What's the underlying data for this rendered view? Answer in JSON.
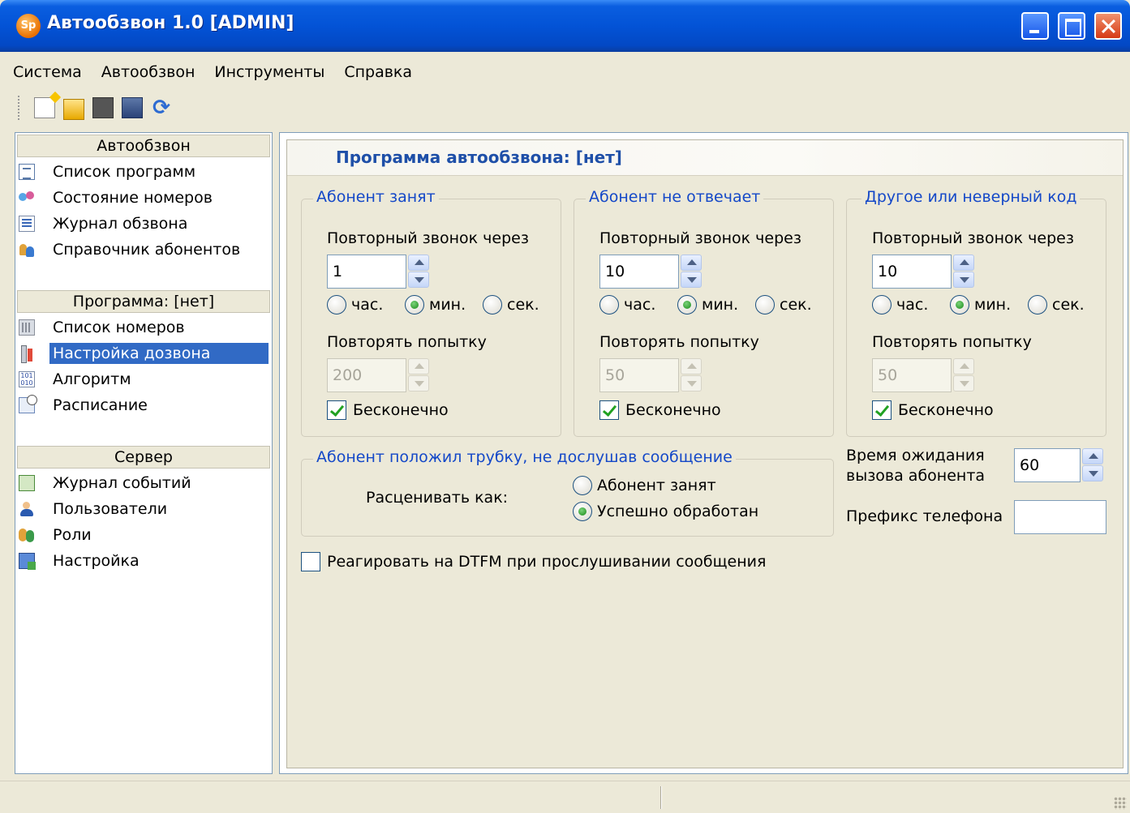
{
  "window": {
    "title": "Автообзвон 1.0 [ADMIN]",
    "app_icon_text": "Sp"
  },
  "menu": [
    "Система",
    "Автообзвон",
    "Инструменты",
    "Справка"
  ],
  "toolbar": {
    "icons": [
      "new-file-icon",
      "open-folder-icon",
      "save-icon",
      "save-all-icon",
      "refresh-icon"
    ]
  },
  "sidebar": {
    "sections": [
      {
        "header": "Автообзвон",
        "items": [
          {
            "label": "Список программ",
            "icon": "list-icon"
          },
          {
            "label": "Состояние номеров",
            "icon": "status-icon"
          },
          {
            "label": "Журнал обзвона",
            "icon": "journal-icon"
          },
          {
            "label": "Справочник абонентов",
            "icon": "address-book-icon"
          }
        ]
      },
      {
        "header": "Программа: [нет]",
        "items": [
          {
            "label": "Список номеров",
            "icon": "phone-list-icon"
          },
          {
            "label": "Настройка дозвона",
            "icon": "tools-icon",
            "selected": true
          },
          {
            "label": "Алгоритм",
            "icon": "algorithm-icon"
          },
          {
            "label": "Расписание",
            "icon": "schedule-icon"
          }
        ]
      },
      {
        "header": "Сервер",
        "items": [
          {
            "label": "Журнал событий",
            "icon": "event-log-icon"
          },
          {
            "label": "Пользователи",
            "icon": "users-icon"
          },
          {
            "label": "Роли",
            "icon": "roles-icon"
          },
          {
            "label": "Настройка",
            "icon": "settings-icon"
          }
        ]
      }
    ]
  },
  "main": {
    "title": "Программа автообзвона: [нет]",
    "groups": [
      {
        "legend": "Абонент занят",
        "retry_label": "Повторный звонок через",
        "retry_value": "1",
        "units": {
          "hour": "час.",
          "min": "мин.",
          "sec": "сек.",
          "selected": "min"
        },
        "repeat_label": "Повторять попытку",
        "repeat_value": "200",
        "infinite_label": "Бесконечно",
        "infinite_checked": true
      },
      {
        "legend": "Абонент не отвечает",
        "retry_label": "Повторный звонок через",
        "retry_value": "10",
        "units": {
          "hour": "час.",
          "min": "мин.",
          "sec": "сек.",
          "selected": "min"
        },
        "repeat_label": "Повторять попытку",
        "repeat_value": "50",
        "infinite_label": "Бесконечно",
        "infinite_checked": true
      },
      {
        "legend": "Другое или неверный код",
        "retry_label": "Повторный звонок через",
        "retry_value": "10",
        "units": {
          "hour": "час.",
          "min": "мин.",
          "sec": "сек.",
          "selected": "min"
        },
        "repeat_label": "Повторять попытку",
        "repeat_value": "50",
        "infinite_label": "Бесконечно",
        "infinite_checked": true
      }
    ],
    "hangup": {
      "legend": "Абонент положил трубку, не дослушав сообщение",
      "rate_label": "Расценивать как:",
      "options": [
        "Абонент занят",
        "Успешно обработан"
      ],
      "selected": 1
    },
    "wait_time": {
      "label_line1": "Время ожидания",
      "label_line2": "вызова абонента",
      "value": "60"
    },
    "prefix": {
      "label": "Префикс телефона",
      "value": ""
    },
    "dtfm": {
      "label": "Реагировать на DTFM при прослушивании сообщения",
      "checked": false
    }
  }
}
